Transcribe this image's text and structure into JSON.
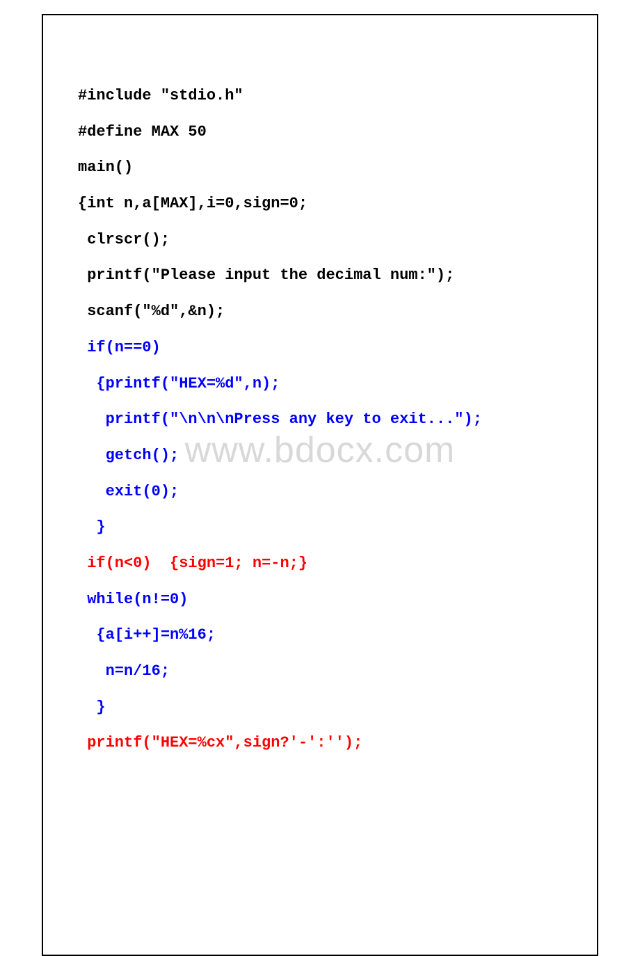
{
  "watermark": "www.bdocx.com",
  "code": {
    "l1": "#include \"stdio.h\"",
    "l2": "#define MAX 50",
    "l3": "main()",
    "l4": "{int n,a[MAX],i=0,sign=0;",
    "l5": " clrscr();",
    "l6": " printf(\"Please input the decimal num:\");",
    "l7": " scanf(\"%d\",&n);",
    "l8": " if(n==0)",
    "l9": "  {printf(\"HEX=%d\",n);",
    "l10": "   printf(\"\\n\\n\\nPress any key to exit...\");",
    "l11": "   getch();",
    "l12": "   exit(0);",
    "l13": "  }",
    "l14": " if(n<0)  {sign=1; n=-n;}",
    "l15": " while(n!=0)",
    "l16": "  {a[i++]=n%16;",
    "l17": "   n=n/16;",
    "l18": "  }",
    "l19": " printf(\"HEX=%cx\",sign?'-':'');"
  }
}
